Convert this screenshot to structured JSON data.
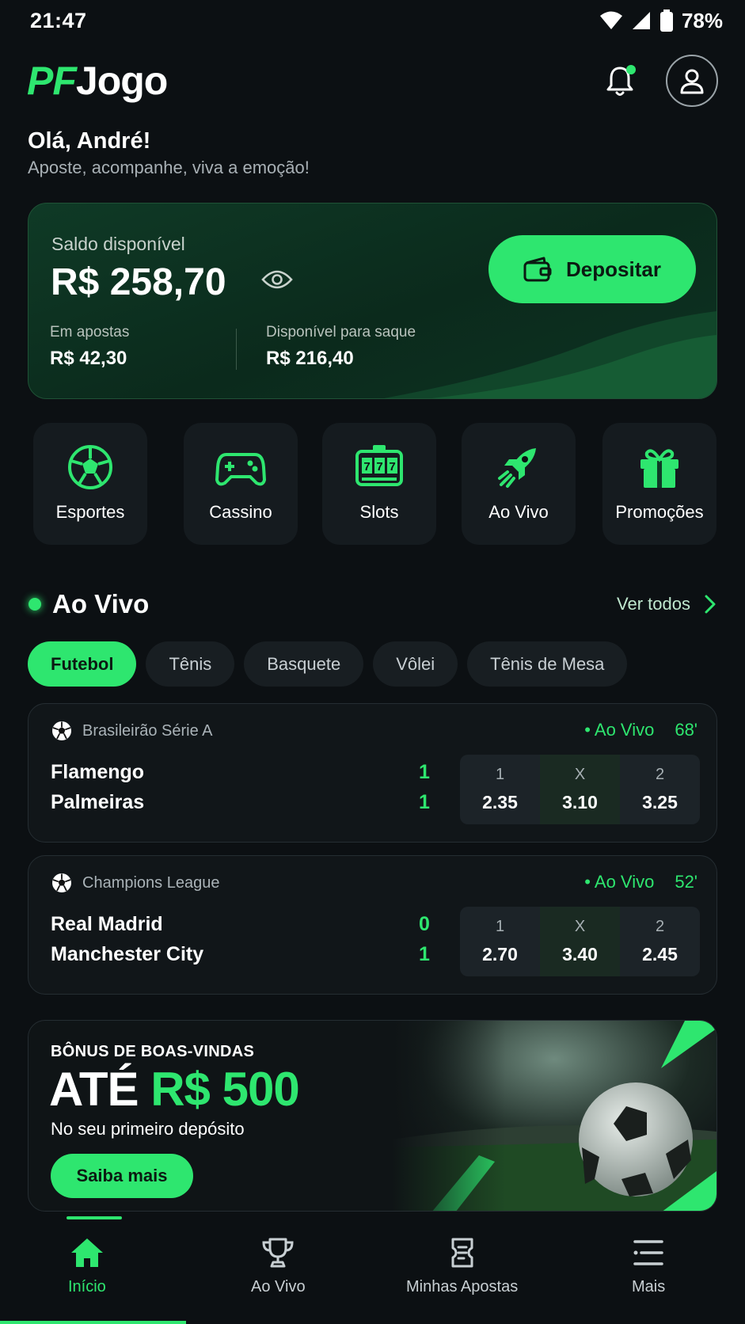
{
  "status_bar": {
    "time": "21:47",
    "battery": "78%"
  },
  "header": {
    "logo_part1": "PF",
    "logo_part2": "Jogo"
  },
  "greeting": {
    "title": "Olá, André!",
    "subtitle": "Aposte, acompanhe, viva a emoção!"
  },
  "balance": {
    "label": "Saldo disponível",
    "amount": "R$ 258,70",
    "deposit_label": "Depositar",
    "in_bets_label": "Em apostas",
    "in_bets_value": "R$ 42,30",
    "withdrawable_label": "Disponível para saque",
    "withdrawable_value": "R$ 216,40"
  },
  "categories": [
    {
      "label": "Esportes",
      "icon": "soccer-ball-icon"
    },
    {
      "label": "Cassino",
      "icon": "gamepad-icon"
    },
    {
      "label": "Slots",
      "icon": "slot-machine-icon"
    },
    {
      "label": "Ao Vivo",
      "icon": "rocket-icon"
    },
    {
      "label": "Promoções",
      "icon": "gift-icon"
    }
  ],
  "live_section": {
    "title": "Ao Vivo",
    "see_all": "Ver todos"
  },
  "sport_tabs": [
    "Futebol",
    "Tênis",
    "Basquete",
    "Vôlei",
    "Tênis de Mesa"
  ],
  "matches": [
    {
      "league": "Brasileirão Série A",
      "live_label": "• Ao Vivo",
      "minute": "68'",
      "home": "Flamengo",
      "away": "Palmeiras",
      "home_score": "1",
      "away_score": "1",
      "odds": [
        {
          "label": "1",
          "value": "2.35"
        },
        {
          "label": "X",
          "value": "3.10"
        },
        {
          "label": "2",
          "value": "3.25"
        }
      ]
    },
    {
      "league": "Champions League",
      "live_label": "• Ao Vivo",
      "minute": "52'",
      "home": "Real Madrid",
      "away": "Manchester City",
      "home_score": "0",
      "away_score": "1",
      "odds": [
        {
          "label": "1",
          "value": "2.70"
        },
        {
          "label": "X",
          "value": "3.40"
        },
        {
          "label": "2",
          "value": "2.45"
        }
      ]
    }
  ],
  "promo": {
    "kicker": "BÔNUS DE BOAS-VINDAS",
    "headline_white": "ATÉ",
    "headline_green": "R$ 500",
    "subtitle": "No seu primeiro depósito",
    "cta": "Saiba mais"
  },
  "bottom_nav": [
    {
      "label": "Início",
      "icon": "home-icon",
      "active": true
    },
    {
      "label": "Ao Vivo",
      "icon": "trophy-icon",
      "active": false
    },
    {
      "label": "Minhas Apostas",
      "icon": "ticket-icon",
      "active": false
    },
    {
      "label": "Mais",
      "icon": "menu-icon",
      "active": false
    }
  ],
  "colors": {
    "accent": "#2ee66f",
    "background": "#0c1013",
    "card": "#151b1f"
  }
}
